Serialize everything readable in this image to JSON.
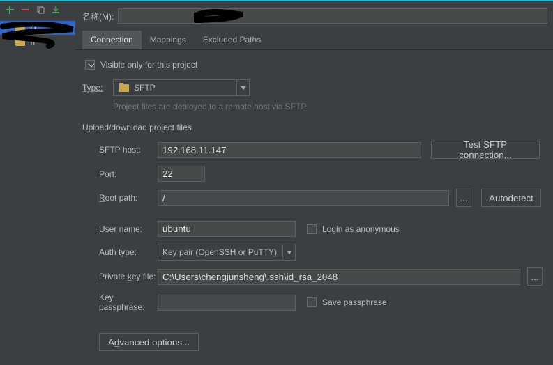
{
  "nameRow": {
    "label": "名称(M):",
    "value": ""
  },
  "sidebar": {
    "items": [
      {
        "label": "fi       t"
      },
      {
        "label": "m"
      }
    ]
  },
  "tabs": [
    {
      "label": "Connection"
    },
    {
      "label": "Mappings"
    },
    {
      "label": "Excluded Paths"
    }
  ],
  "visibleOnly": {
    "label": "Visible only for this project",
    "checked": true
  },
  "typeRow": {
    "label": "Type:",
    "value": "SFTP"
  },
  "hint": "Project files are deployed to a remote host via SFTP",
  "sectionTitle": "Upload/download project files",
  "host": {
    "label": "SFTP host:",
    "value": "192.168.11.147"
  },
  "testBtn": "Test SFTP connection...",
  "port": {
    "label": "Port:",
    "value": "22"
  },
  "rootPath": {
    "label": "Root path:",
    "value": "/"
  },
  "browseBtn": "...",
  "autodetectBtn": "Autodetect",
  "user": {
    "label": "User name:",
    "value": "ubuntu"
  },
  "loginAnon": {
    "label": "Login as anonymous",
    "checked": false
  },
  "authType": {
    "label": "Auth type:",
    "value": "Key pair (OpenSSH or PuTTY)"
  },
  "privateKey": {
    "label": "Private key file:",
    "value": "C:\\Users\\chengjunsheng\\.ssh\\id_rsa_2048"
  },
  "keyBrowseBtn": "...",
  "passphrase": {
    "label": "Key passphrase:",
    "value": ""
  },
  "savePass": {
    "label": "Save passphrase",
    "checked": false
  },
  "advancedBtn": "Advanced options..."
}
